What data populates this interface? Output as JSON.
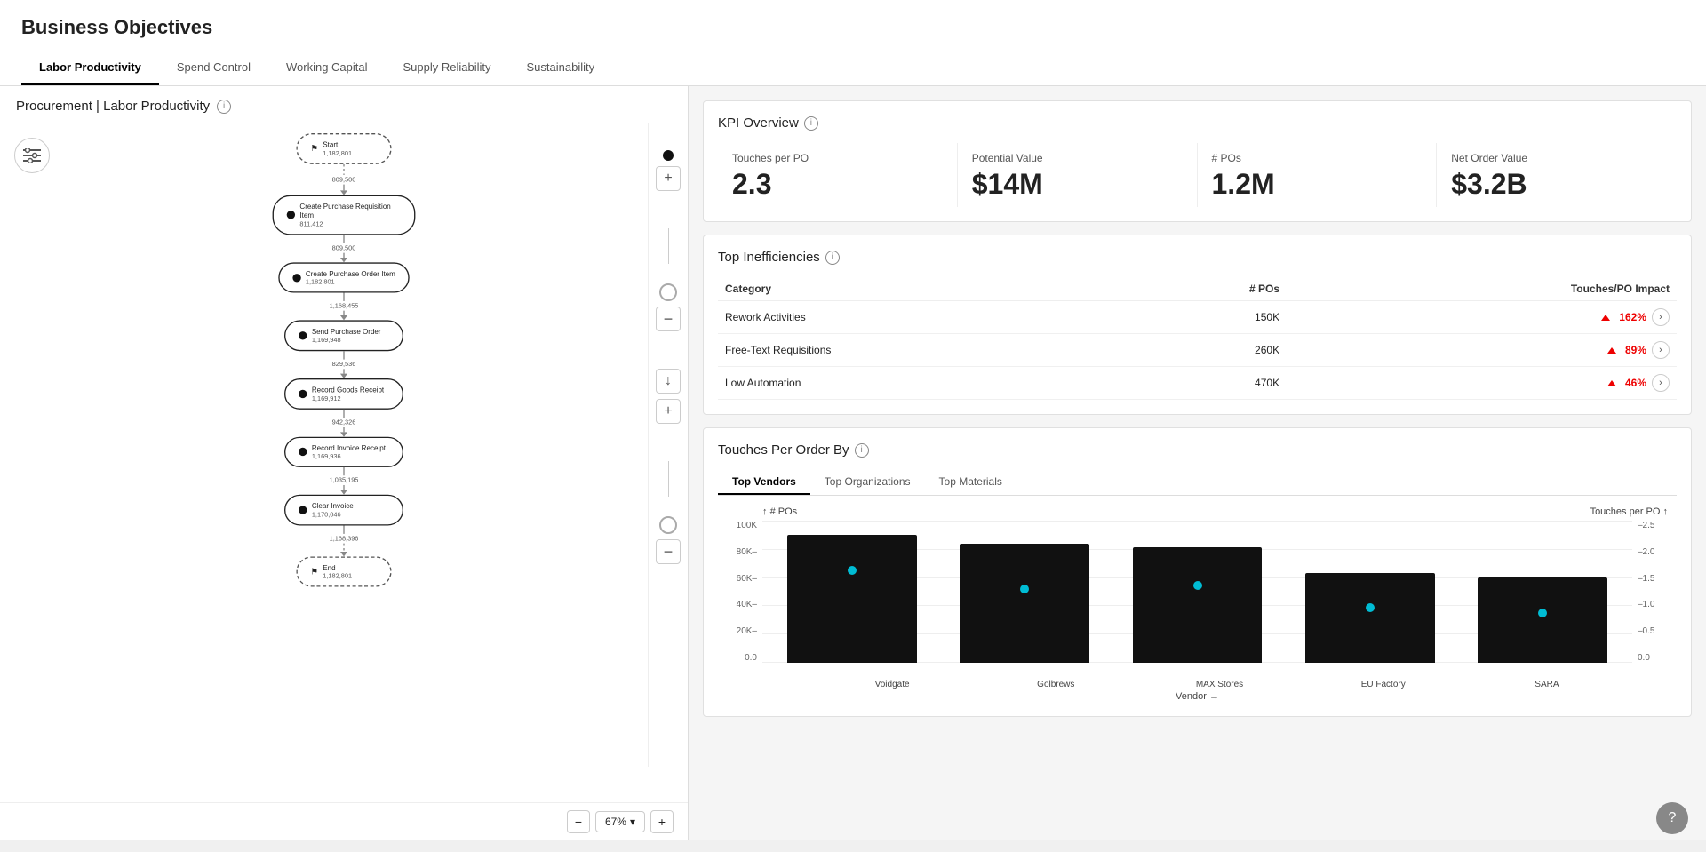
{
  "app": {
    "title": "Business Objectives"
  },
  "tabs": [
    {
      "id": "labor-productivity",
      "label": "Labor Productivity",
      "active": true
    },
    {
      "id": "spend-control",
      "label": "Spend Control",
      "active": false
    },
    {
      "id": "working-capital",
      "label": "Working Capital",
      "active": false
    },
    {
      "id": "supply-reliability",
      "label": "Supply Reliability",
      "active": false
    },
    {
      "id": "sustainability",
      "label": "Sustainability",
      "active": false
    }
  ],
  "left_panel": {
    "title": "Procurement | Labor Productivity",
    "flow_nodes": [
      {
        "id": "start",
        "label": "Start",
        "count": "1,182,801",
        "type": "start"
      },
      {
        "id": "create-pr",
        "label": "Create Purchase Requisition Item",
        "count": "811,412",
        "type": "node"
      },
      {
        "id": "create-po",
        "label": "Create Purchase Order Item",
        "count": "1,182,801",
        "type": "node"
      },
      {
        "id": "send-po",
        "label": "Send Purchase Order",
        "count": "1,169,948",
        "type": "node"
      },
      {
        "id": "record-gr",
        "label": "Record Goods Receipt",
        "count": "1,169,912",
        "type": "node"
      },
      {
        "id": "record-ir",
        "label": "Record Invoice Receipt",
        "count": "1,169,936",
        "type": "node"
      },
      {
        "id": "clear-inv",
        "label": "Clear Invoice",
        "count": "1,170,046",
        "type": "node"
      },
      {
        "id": "end",
        "label": "End",
        "count": "1,182,801",
        "type": "end"
      }
    ],
    "connectors": [
      "809,500",
      "809,500",
      "1,168,455",
      "829,536",
      "942,326",
      "1,035,195",
      "1,168,396"
    ],
    "zoom_level": "67%"
  },
  "kpi_overview": {
    "title": "KPI Overview",
    "items": [
      {
        "label": "Touches per PO",
        "value": "2.3"
      },
      {
        "label": "Potential Value",
        "value": "$14M"
      },
      {
        "label": "# POs",
        "value": "1.2M"
      },
      {
        "label": "Net Order Value",
        "value": "$3.2B"
      }
    ]
  },
  "top_inefficiencies": {
    "title": "Top Inefficiencies",
    "columns": [
      "Category",
      "# POs",
      "Touches/PO Impact"
    ],
    "rows": [
      {
        "category": "Rework Activities",
        "pos": "150K",
        "impact": "162%"
      },
      {
        "category": "Free-Text Requisitions",
        "pos": "260K",
        "impact": "89%"
      },
      {
        "category": "Low Automation",
        "pos": "470K",
        "impact": "46%"
      }
    ]
  },
  "touches_per_order": {
    "title": "Touches Per Order By",
    "tabs": [
      "Top Vendors",
      "Top Organizations",
      "Top Materials"
    ],
    "active_tab": "Top Vendors",
    "y_axis_left_label": "# POs",
    "y_axis_right_label": "Touches per PO",
    "y_labels_left": [
      "100K",
      "80K–",
      "60K–",
      "40K–",
      "20K–",
      "0.0"
    ],
    "y_labels_right": [
      "2.5",
      "2.0",
      "1.5",
      "1.0",
      "0.5",
      "0.0"
    ],
    "x_axis_title": "Vendor →",
    "bars": [
      {
        "label": "Voidgate",
        "height_pct": 90,
        "dot_pct": 68
      },
      {
        "label": "Golbrews",
        "height_pct": 84,
        "dot_pct": 55
      },
      {
        "label": "MAX Stores",
        "height_pct": 81,
        "dot_pct": 58
      },
      {
        "label": "EU Factory",
        "height_pct": 63,
        "dot_pct": 42
      },
      {
        "label": "SARA",
        "height_pct": 60,
        "dot_pct": 38
      }
    ]
  }
}
